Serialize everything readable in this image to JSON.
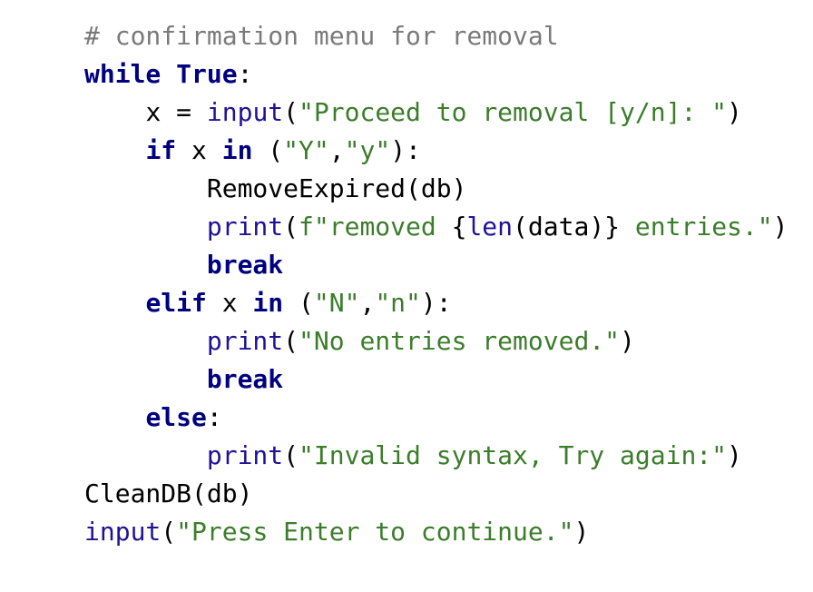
{
  "code": {
    "lines": [
      {
        "indent": 0,
        "tokens": [
          {
            "text": "# confirmation menu for removal",
            "kind": "comment"
          }
        ]
      },
      {
        "indent": 0,
        "tokens": [
          {
            "text": "while",
            "kind": "kw"
          },
          {
            "text": " ",
            "kind": "plain"
          },
          {
            "text": "True",
            "kind": "kw"
          },
          {
            "text": ":",
            "kind": "plain"
          }
        ]
      },
      {
        "indent": 1,
        "tokens": [
          {
            "text": "x = ",
            "kind": "plain"
          },
          {
            "text": "input",
            "kind": "builtin"
          },
          {
            "text": "(",
            "kind": "plain"
          },
          {
            "text": "\"Proceed to removal [y/n]: \"",
            "kind": "string"
          },
          {
            "text": ")",
            "kind": "plain"
          }
        ]
      },
      {
        "indent": 1,
        "tokens": [
          {
            "text": "if",
            "kind": "kw"
          },
          {
            "text": " x ",
            "kind": "plain"
          },
          {
            "text": "in",
            "kind": "kw"
          },
          {
            "text": " (",
            "kind": "plain"
          },
          {
            "text": "\"Y\"",
            "kind": "string"
          },
          {
            "text": ",",
            "kind": "plain"
          },
          {
            "text": "\"y\"",
            "kind": "string"
          },
          {
            "text": "):",
            "kind": "plain"
          }
        ]
      },
      {
        "indent": 2,
        "tokens": [
          {
            "text": "RemoveExpired(db)",
            "kind": "plain"
          }
        ]
      },
      {
        "indent": 2,
        "tokens": [
          {
            "text": "print",
            "kind": "builtin"
          },
          {
            "text": "(",
            "kind": "plain"
          },
          {
            "text": "f\"removed ",
            "kind": "string"
          },
          {
            "text": "{",
            "kind": "plain"
          },
          {
            "text": "len",
            "kind": "builtin"
          },
          {
            "text": "(data)}",
            "kind": "plain"
          },
          {
            "text": " entries.\"",
            "kind": "string"
          },
          {
            "text": ")",
            "kind": "plain"
          }
        ]
      },
      {
        "indent": 2,
        "tokens": [
          {
            "text": "break",
            "kind": "kw"
          }
        ]
      },
      {
        "indent": 1,
        "tokens": [
          {
            "text": "elif",
            "kind": "kw"
          },
          {
            "text": " x ",
            "kind": "plain"
          },
          {
            "text": "in",
            "kind": "kw"
          },
          {
            "text": " (",
            "kind": "plain"
          },
          {
            "text": "\"N\"",
            "kind": "string"
          },
          {
            "text": ",",
            "kind": "plain"
          },
          {
            "text": "\"n\"",
            "kind": "string"
          },
          {
            "text": "):",
            "kind": "plain"
          }
        ]
      },
      {
        "indent": 2,
        "tokens": [
          {
            "text": "print",
            "kind": "builtin"
          },
          {
            "text": "(",
            "kind": "plain"
          },
          {
            "text": "\"No entries removed.\"",
            "kind": "string"
          },
          {
            "text": ")",
            "kind": "plain"
          }
        ]
      },
      {
        "indent": 2,
        "tokens": [
          {
            "text": "break",
            "kind": "kw"
          }
        ]
      },
      {
        "indent": 1,
        "tokens": [
          {
            "text": "else",
            "kind": "kw"
          },
          {
            "text": ":",
            "kind": "plain"
          }
        ]
      },
      {
        "indent": 2,
        "tokens": [
          {
            "text": "print",
            "kind": "builtin"
          },
          {
            "text": "(",
            "kind": "plain"
          },
          {
            "text": "\"Invalid syntax, Try again:\"",
            "kind": "string"
          },
          {
            "text": ")",
            "kind": "plain"
          }
        ]
      },
      {
        "indent": 0,
        "tokens": [
          {
            "text": "CleanDB(db)",
            "kind": "plain"
          }
        ]
      },
      {
        "indent": 0,
        "tokens": [
          {
            "text": "input",
            "kind": "builtin"
          },
          {
            "text": "(",
            "kind": "plain"
          },
          {
            "text": "\"Press Enter to continue.\"",
            "kind": "string"
          },
          {
            "text": ")",
            "kind": "plain"
          }
        ]
      }
    ]
  },
  "colors": {
    "keyword": "#000080",
    "builtin": "#1f1296",
    "string": "#3b7d2b",
    "comment": "#7a7a7a",
    "plain": "#000000",
    "background": "#ffffff"
  }
}
